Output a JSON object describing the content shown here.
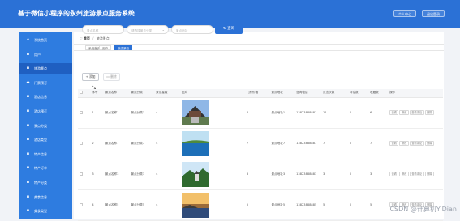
{
  "app": {
    "title": "基于微信小程序的永州旅游景点服务系统",
    "user_center": "个人中心",
    "logout": "退出登录"
  },
  "sidebar": {
    "items": [
      {
        "label": "系统首页",
        "icon": "home-icon",
        "glyph": "⌂",
        "active": false
      },
      {
        "label": "用户",
        "icon": "user-icon",
        "glyph": "▪",
        "active": false
      },
      {
        "label": "旅游景点",
        "icon": "scenic-icon",
        "glyph": "▪",
        "active": true
      },
      {
        "label": "门票预订",
        "icon": "ticket-icon",
        "glyph": "◆",
        "active": false
      },
      {
        "label": "酒店信息",
        "icon": "hotel-icon",
        "glyph": "▪",
        "active": false
      },
      {
        "label": "酒店预订",
        "icon": "booking-icon",
        "glyph": "▪",
        "active": false
      },
      {
        "label": "景点分类",
        "icon": "category-icon",
        "glyph": "▪",
        "active": false
      },
      {
        "label": "酒店类型",
        "icon": "type-icon",
        "glyph": "▪",
        "active": false
      },
      {
        "label": "特产信息",
        "icon": "specialty-icon",
        "glyph": "▪",
        "active": false
      },
      {
        "label": "特产订单",
        "icon": "order-icon",
        "glyph": "▪",
        "active": false
      },
      {
        "label": "特产分类",
        "icon": "specialty-category-icon",
        "glyph": "▪",
        "active": false
      },
      {
        "label": "美食信息",
        "icon": "food-icon",
        "glyph": "▪",
        "active": false
      },
      {
        "label": "美食类型",
        "icon": "food-type-icon",
        "glyph": "▪",
        "active": false
      }
    ]
  },
  "breadcrumb": {
    "home": "首页",
    "current": "旅游景点"
  },
  "tabs": [
    {
      "label": "系统首页",
      "active": false
    },
    {
      "label": "用户",
      "active": false
    },
    {
      "label": "旅游景点",
      "active": true
    }
  ],
  "filters": {
    "name_placeholder": "景点名称",
    "category_placeholder": "请选择景点分类",
    "location_placeholder": "景点地址",
    "query_label": "查询"
  },
  "actions": {
    "add_label": "+ 添加",
    "delete_label": "删除"
  },
  "table": {
    "columns": [
      "",
      "序号",
      "景点名称",
      "景点分类",
      "景点星级",
      "图片",
      "门票价格",
      "景点地址",
      "咨询电话",
      "点击次数",
      "评论数",
      "收藏数",
      "操作"
    ],
    "op_labels": [
      "查看",
      "修改",
      "查看评论",
      "删除"
    ],
    "rows": [
      {
        "no": "1",
        "name": "景点名称1",
        "category": "景点分类1",
        "star": "4",
        "price": "6",
        "address": "景点地址1",
        "phone": "13823888881",
        "clicks": "11",
        "comments": "0",
        "favorites": "6"
      },
      {
        "no": "2",
        "name": "景点名称7",
        "category": "景点分类7",
        "star": "4",
        "price": "7",
        "address": "景点地址7",
        "phone": "13823888887",
        "clicks": "7",
        "comments": "0",
        "favorites": "7"
      },
      {
        "no": "3",
        "name": "景点名称3",
        "category": "景点分类3",
        "star": "4",
        "price": "3",
        "address": "景点地址3",
        "phone": "13823888883",
        "clicks": "3",
        "comments": "0",
        "favorites": "3"
      },
      {
        "no": "4",
        "name": "景点名称5",
        "category": "景点分类5",
        "star": "4",
        "price": "5",
        "address": "景点地址5",
        "phone": "13823888885",
        "clicks": "5",
        "comments": "0",
        "favorites": "5"
      }
    ]
  },
  "watermark": "CSDN @计算机YiDian",
  "colors": {
    "primary": "#2b71d6",
    "sidebar": "#2e7ce0",
    "sidebar_active": "#1f5fc1",
    "background": "#f1f3f7"
  }
}
